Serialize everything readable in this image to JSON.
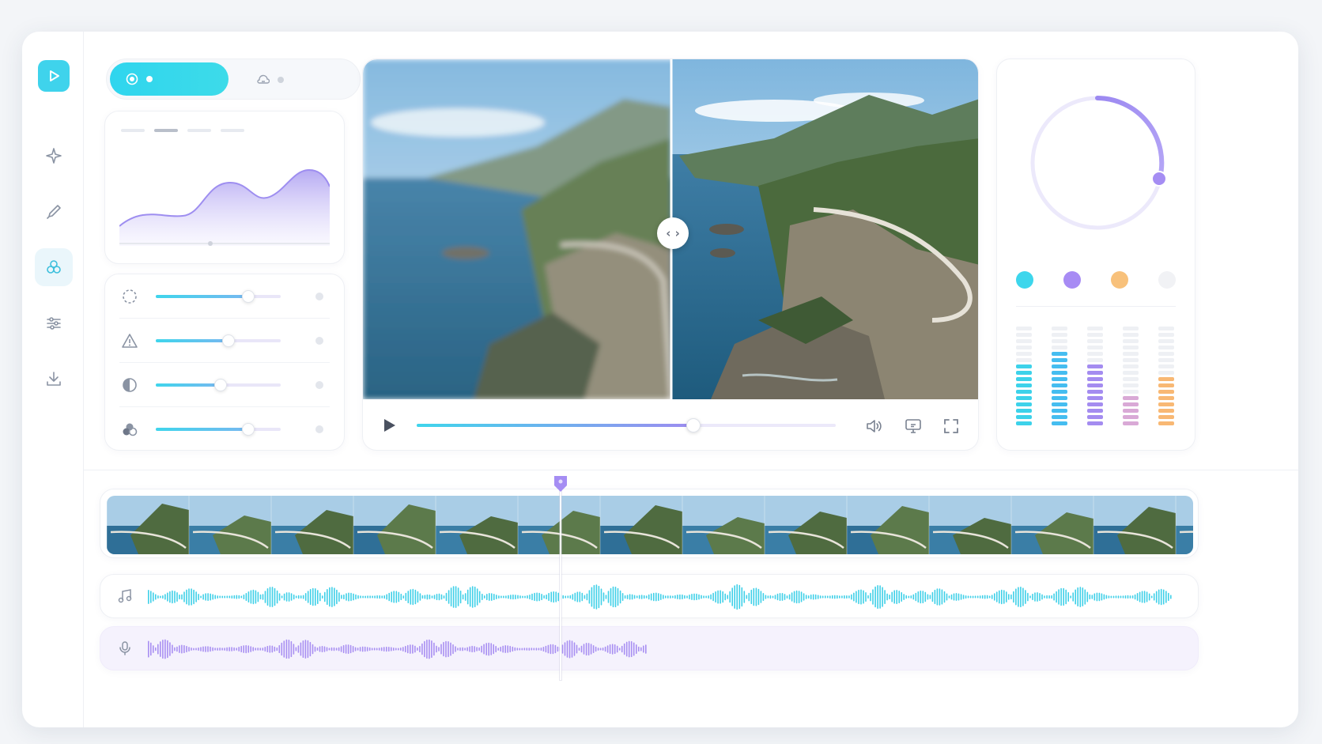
{
  "app": {
    "name": ""
  },
  "sidebar": {
    "items": [
      {
        "icon": "sparkle-icon",
        "active": false
      },
      {
        "icon": "brush-icon",
        "active": false
      },
      {
        "icon": "effects-icon",
        "active": true
      },
      {
        "icon": "sliders-icon",
        "active": false
      },
      {
        "icon": "download-icon",
        "active": false
      }
    ]
  },
  "mode_toggle": {
    "active_icon": "record-icon",
    "inactive_icon": "cloud-icon"
  },
  "adjustments": [
    {
      "icon": "dashed-circle-icon",
      "value": 0.74
    },
    {
      "icon": "triangle-warning-icon",
      "value": 0.58
    },
    {
      "icon": "contrast-icon",
      "value": 0.52
    },
    {
      "icon": "color-blend-icon",
      "value": 0.74
    }
  ],
  "preview": {
    "compare_split": 0.5
  },
  "playback": {
    "progress": 0.66
  },
  "dial": {
    "value": 0.3
  },
  "swatches": [
    "#3dd6ec",
    "#a78bf4",
    "#f8c17b",
    "#f1f2f5"
  ],
  "level_meters": [
    {
      "color": "#3dd2ea",
      "level": 0.6
    },
    {
      "color": "#45bdf0",
      "level": 0.73
    },
    {
      "color": "#a48cf0",
      "level": 0.6
    },
    {
      "color": "#d9a9d6",
      "level": 0.33
    },
    {
      "color": "#f8b874",
      "level": 0.53
    }
  ],
  "timeline": {
    "playhead": 0.418
  },
  "tracks": {
    "music_icon": "music-note-icon",
    "voice_icon": "microphone-icon"
  },
  "colors": {
    "accent_cyan": "#35d4ec",
    "accent_purple": "#a78bf4"
  }
}
